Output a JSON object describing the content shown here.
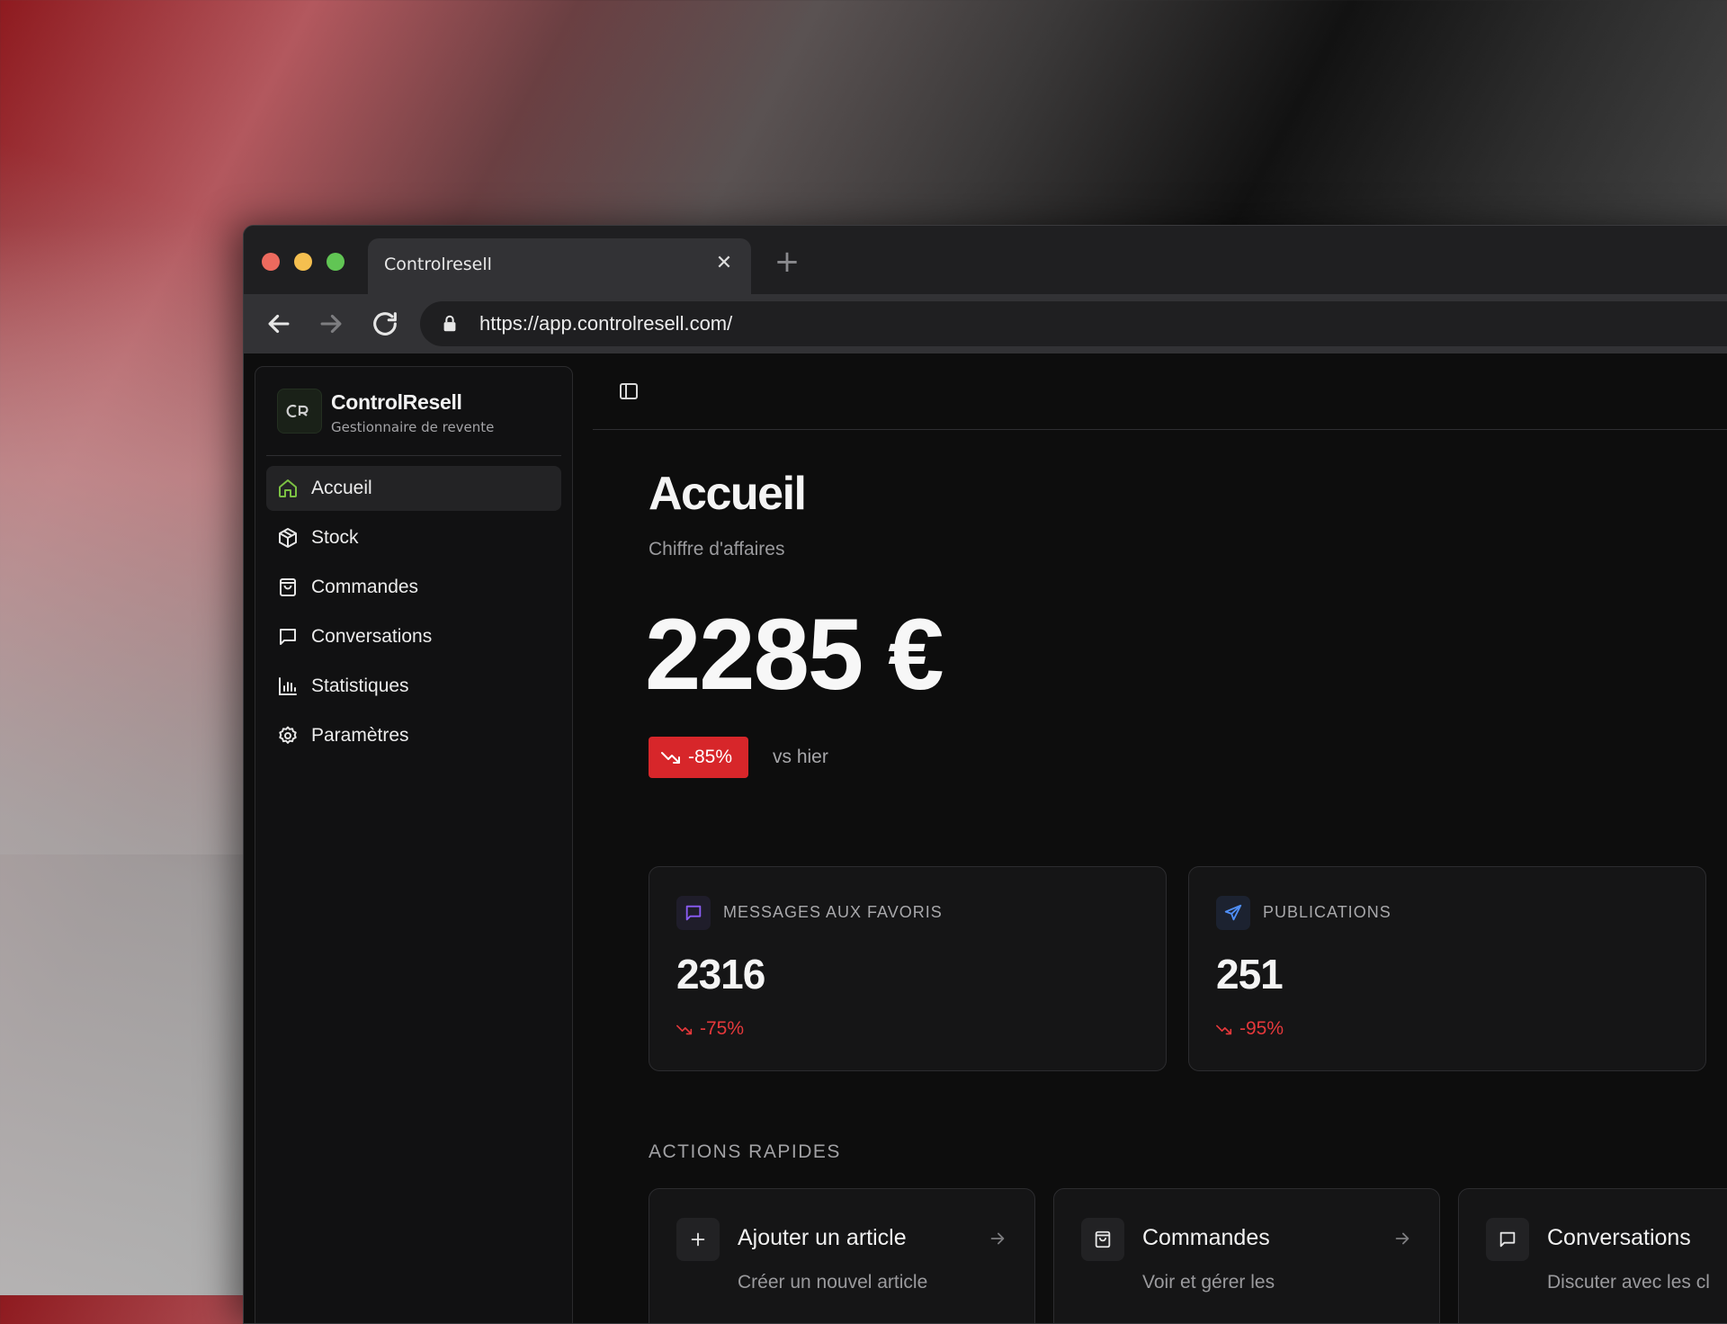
{
  "browser": {
    "tab_title": "Controlresell",
    "tab_close": "✕",
    "new_tab": "+",
    "url": "https://app.controlresell.com/"
  },
  "brand": {
    "name": "ControlResell",
    "subtitle": "Gestionnaire de revente",
    "accent": "#7bc043"
  },
  "sidebar": {
    "items": [
      {
        "label": "Accueil",
        "icon": "home-icon",
        "active": true
      },
      {
        "label": "Stock",
        "icon": "package-icon"
      },
      {
        "label": "Commandes",
        "icon": "shopping-bag-icon"
      },
      {
        "label": "Conversations",
        "icon": "message-icon"
      },
      {
        "label": "Statistiques",
        "icon": "bar-chart-icon"
      },
      {
        "label": "Paramètres",
        "icon": "gear-icon"
      }
    ]
  },
  "page": {
    "title": "Accueil",
    "subtitle": "Chiffre d'affaires",
    "revenue": "2285 €",
    "trend": "-85%",
    "trend_compare": "vs hier"
  },
  "stats": [
    {
      "label": "MESSAGES AUX FAVORIS",
      "value": "2316",
      "trend": "-75%",
      "icon": "message-icon",
      "icon_color": "#8b5cf6"
    },
    {
      "label": "PUBLICATIONS",
      "value": "251",
      "trend": "-95%",
      "icon": "send-icon",
      "icon_color": "#4f8ef7"
    }
  ],
  "quick_actions": {
    "title": "ACTIONS RAPIDES",
    "items": [
      {
        "title": "Ajouter un article",
        "desc": "Créer un nouvel article",
        "icon": "plus-icon"
      },
      {
        "title": "Commandes",
        "desc": "Voir et gérer les",
        "icon": "shopping-bag-icon"
      },
      {
        "title": "Conversations",
        "desc": "Discuter avec les cl",
        "icon": "message-icon"
      }
    ]
  },
  "colors": {
    "negative": "#e5383b",
    "badge_red": "#d7262a"
  }
}
